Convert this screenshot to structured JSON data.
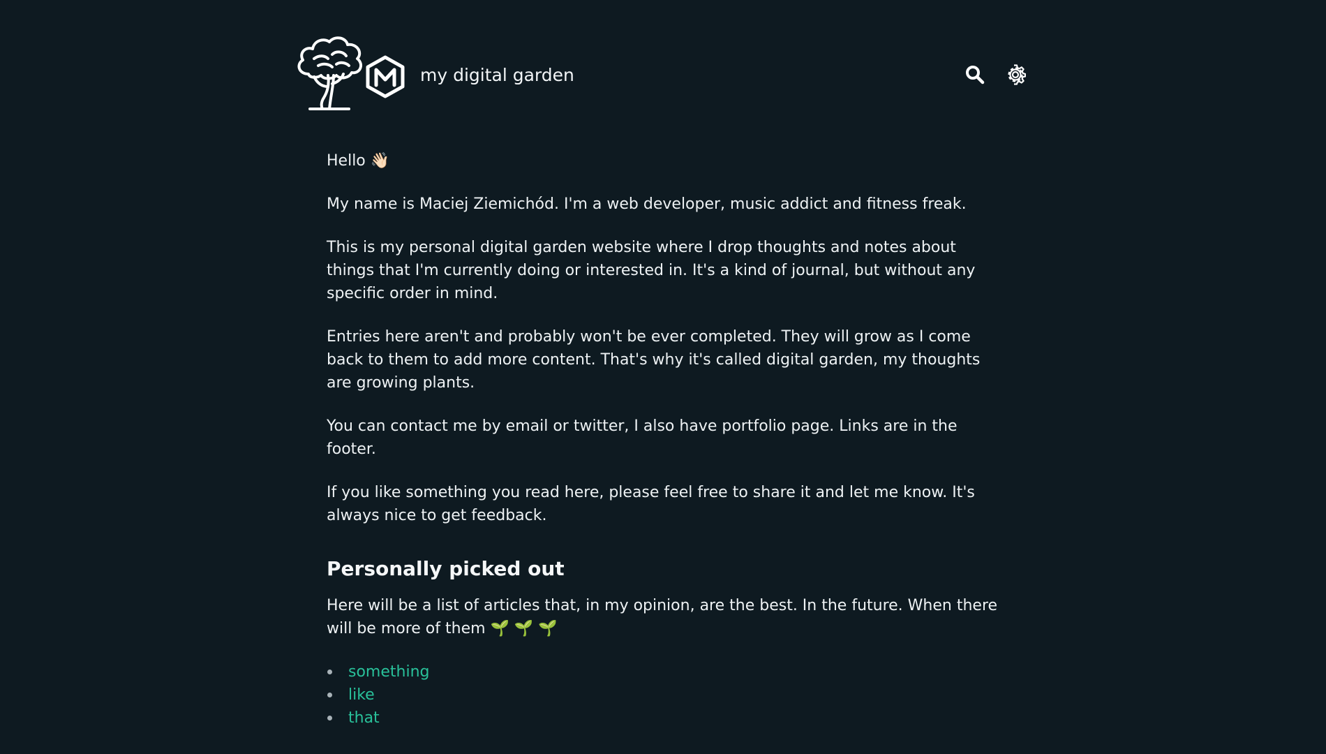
{
  "header": {
    "site_title": "my digital garden",
    "logo_icons": [
      "tree-icon",
      "m-hexagon-icon"
    ],
    "actions": [
      {
        "icon": "search-icon"
      },
      {
        "icon": "gear-icon"
      }
    ]
  },
  "intro": {
    "greeting": "Hello",
    "greeting_emoji": "👋🏻",
    "paragraphs": [
      "My name is Maciej Ziemichód. I'm a web developer, music addict and fitness freak.",
      "This is my personal digital garden website where I drop thoughts and notes about things that I'm currently doing or interested in. It's a kind of journal, but without any specific order in mind.",
      "Entries here aren't and probably won't be ever completed. They will grow as I come back to them to add more content. That's why it's called digital garden, my thoughts are growing plants.",
      "You can contact me by email or twitter, I also have portfolio page. Links are in the footer.",
      "If you like something you read here, please feel free to share it and let me know. It's always nice to get feedback."
    ]
  },
  "picked": {
    "heading": "Personally picked out",
    "description": "Here will be a list of articles that, in my opinion, are the best. In the future. When there will be more of them",
    "description_emoji": "🌱 🌱 🌱",
    "links": [
      {
        "label": "something"
      },
      {
        "label": "like"
      },
      {
        "label": "that"
      }
    ]
  },
  "colors": {
    "background": "#0e1a21",
    "text": "#eef2f4",
    "link": "#29c19a"
  }
}
